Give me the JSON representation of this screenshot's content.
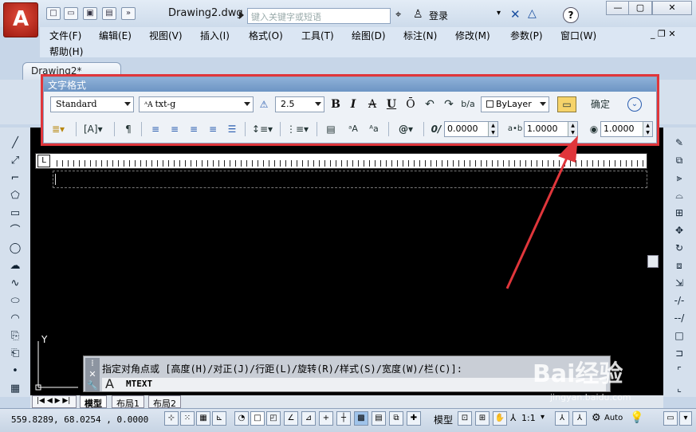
{
  "title": {
    "doc": "Drawing2.dwg",
    "search_placeholder": "键入关键字或短语",
    "login": "登录"
  },
  "app_icon": "A",
  "menu": [
    "文件(F)",
    "编辑(E)",
    "视图(V)",
    "插入(I)",
    "格式(O)",
    "工具(T)",
    "绘图(D)",
    "标注(N)",
    "修改(M)",
    "参数(P)",
    "窗口(W)",
    "帮助(H)"
  ],
  "doc_tab": "Drawing2*",
  "text_format": {
    "title": "文字格式",
    "style": "Standard",
    "font": "txt-g",
    "height": "2.5",
    "color": "ByLayer",
    "ok": "确定",
    "oblique": "0.0000",
    "tracking": "1.0000",
    "width_factor": "1.0000",
    "bold": "B",
    "italic": "I",
    "strike": "A",
    "underline": "U",
    "overline": "Ō"
  },
  "command": {
    "prompt": "指定对角点或 [高度(H)/对正(J)/行距(L)/旋转(R)/样式(S)/宽度(W)/栏(C)]:",
    "cmd": "MTEXT",
    "prefix": "A"
  },
  "layout_tabs": [
    "模型",
    "布局1",
    "布局2"
  ],
  "status": {
    "coords": "559.8289, 68.0254 , 0.0000",
    "model": "模型",
    "scale": "1:1",
    "auto": "Auto"
  },
  "watermark": {
    "main": "Bai经验",
    "sub": "jingyan.baidu.com"
  },
  "accent": "#e0363b"
}
